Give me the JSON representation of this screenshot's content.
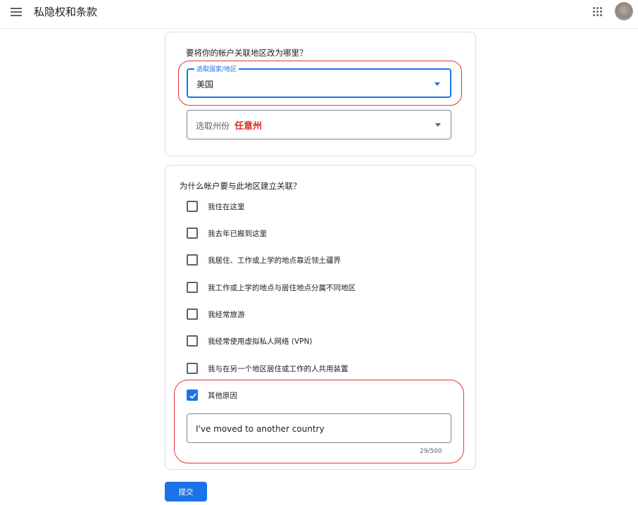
{
  "header": {
    "title": "私隐权和条款",
    "menu_icon": "hamburger-menu-icon",
    "apps_icon": "google-apps-grid-icon"
  },
  "region_card": {
    "question": "要将你的帐户关联地区改为哪里？",
    "country_select": {
      "label": "选取国家/地区",
      "value": "美国"
    },
    "state_select": {
      "placeholder": "选取州份",
      "annotation": "任意州"
    }
  },
  "reason_card": {
    "question": "为什么帐户要与此地区建立关联？",
    "options": [
      {
        "label": "我住在这里",
        "checked": false
      },
      {
        "label": "我去年已搬到这里",
        "checked": false
      },
      {
        "label": "我居住、工作或上学的地点靠近领土疆界",
        "checked": false
      },
      {
        "label": "我工作或上学的地点与居住地点分属不同地区",
        "checked": false
      },
      {
        "label": "我经常旅游",
        "checked": false
      },
      {
        "label": "我经常使用虚拟私人网络 (VPN)",
        "checked": false
      },
      {
        "label": "我与在另一个地区居住或工作的人共用装置",
        "checked": false
      },
      {
        "label": "其他原因",
        "checked": true
      }
    ],
    "other_reason": {
      "value": "I've moved to another country",
      "char_count": "29/500"
    }
  },
  "submit_label": "提交",
  "colors": {
    "accent": "#1a73e8",
    "annotation": "#d93025"
  }
}
